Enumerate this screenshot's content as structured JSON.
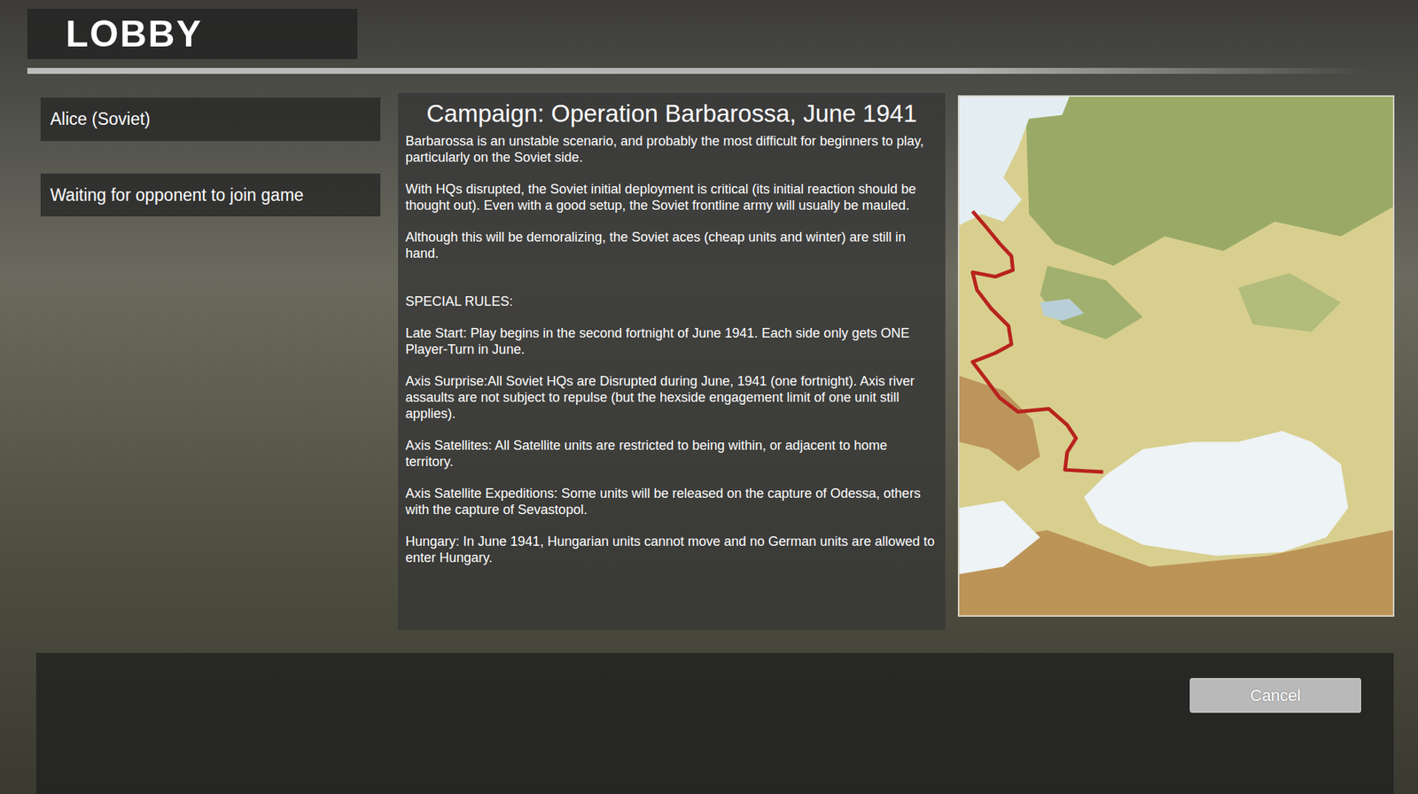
{
  "title": "LOBBY",
  "players": [
    {
      "label": "Alice (Soviet)"
    },
    {
      "label": "Waiting for opponent to join game"
    }
  ],
  "campaign": {
    "title": "Campaign: Operation Barbarossa, June 1941",
    "paragraphs": [
      "Barbarossa is an unstable scenario, and probably the most difficult for beginners to play, particularly on the Soviet side.",
      "With HQs disrupted, the Soviet initial deployment is critical (its initial reaction should be thought out). Even with a good setup, the Soviet frontline army will usually be mauled.",
      "Although this will be demoralizing, the Soviet aces (cheap units and winter) are still in hand."
    ],
    "rules_heading": "SPECIAL RULES:",
    "rules": [
      "Late Start: Play begins in the second fortnight of June 1941. Each side only gets ONE Player-Turn in June.",
      "Axis Surprise:All Soviet HQs are Disrupted during June, 1941 (one fortnight). Axis river assaults are not subject to repulse (but the hexside engagement limit of one unit still applies).",
      "Axis Satellites: All Satellite units are restricted to being within, or adjacent to home territory.",
      "Axis Satellite Expeditions: Some units will be released on the capture of Odessa, others with the capture of Sevastopol.",
      "Hungary: In June 1941, Hungarian units cannot move and no German units are allowed to enter Hungary."
    ]
  },
  "buttons": [
    {
      "label": "Cancel"
    }
  ]
}
